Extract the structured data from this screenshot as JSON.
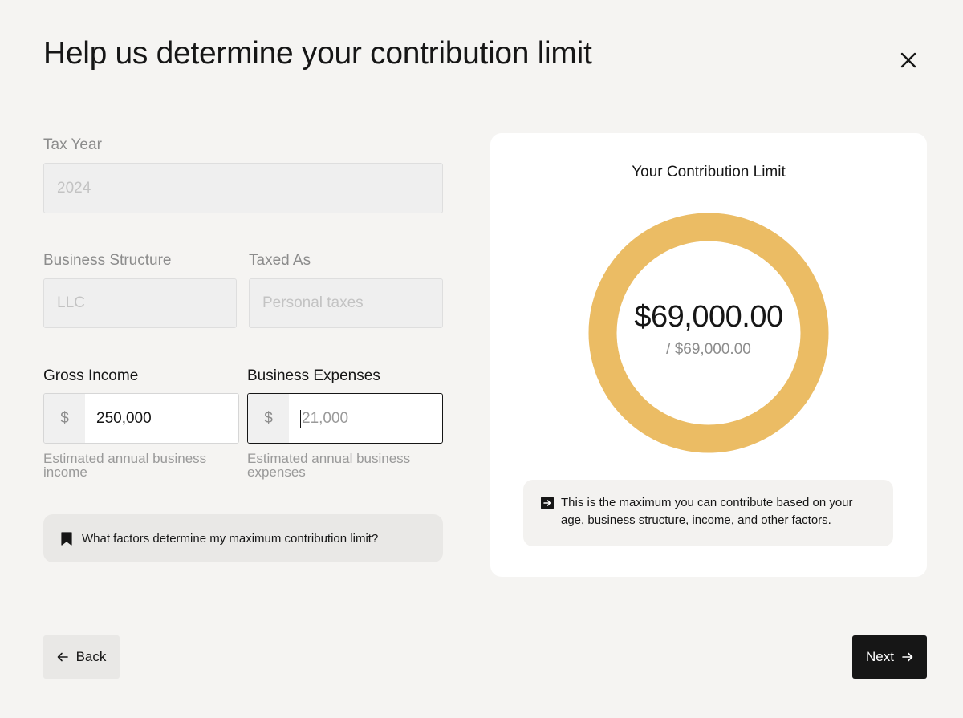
{
  "page": {
    "title": "Help us determine your contribution limit",
    "close_icon": "close-icon"
  },
  "form": {
    "tax_year": {
      "label": "Tax Year",
      "value": "2024",
      "disabled": true
    },
    "business_structure": {
      "label": "Business Structure",
      "value": "LLC",
      "disabled": true
    },
    "taxed_as": {
      "label": "Taxed As",
      "value": "Personal taxes",
      "disabled": true
    },
    "gross_income": {
      "label": "Gross Income",
      "prefix": "$",
      "value": "250,000",
      "helper": "Estimated annual business income"
    },
    "business_expenses": {
      "label": "Business Expenses",
      "prefix": "$",
      "value": "21,000",
      "helper": "Estimated annual business expenses",
      "focused": true
    },
    "faq": {
      "icon": "bookmark-icon",
      "text": "What factors determine my maximum contribution limit?"
    }
  },
  "summary": {
    "title": "Your Contribution Limit",
    "amount": "$69,000.00",
    "total": "/ $69,000.00",
    "progress_fraction": 1.0,
    "ring_color": "#ebbc64",
    "info_icon": "arrow-right-square-icon",
    "info_text": "This is the maximum you can contribute based on your age, business structure, income, and other factors."
  },
  "nav": {
    "back_label": "Back",
    "back_icon": "arrow-left-icon",
    "next_label": "Next",
    "next_icon": "arrow-right-icon"
  }
}
